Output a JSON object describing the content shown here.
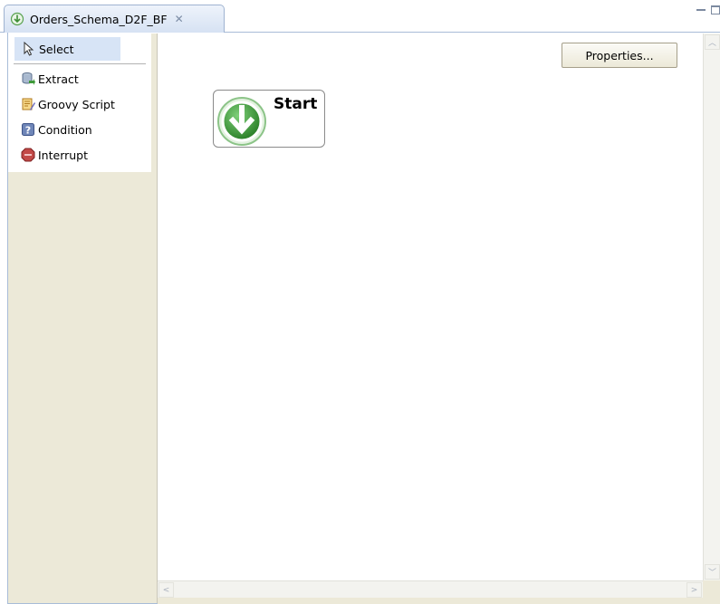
{
  "editor": {
    "tab_title": "Orders_Schema_D2F_BF",
    "tab_close": "✕",
    "tab_icon": "flow-icon"
  },
  "palette": {
    "items": [
      {
        "label": "Select",
        "icon": "select-arrow-icon",
        "selected": true
      },
      {
        "label": "Extract",
        "icon": "extract-icon"
      },
      {
        "label": "Groovy Script",
        "icon": "groovy-script-icon"
      },
      {
        "label": "Condition",
        "icon": "condition-icon"
      },
      {
        "label": "Interrupt",
        "icon": "interrupt-icon"
      }
    ]
  },
  "canvas": {
    "properties_button": "Properties...",
    "start_node": {
      "label": "Start",
      "icon": "start-arrow-icon"
    }
  },
  "scrollbars": {
    "up_arrow": "︿",
    "down_arrow": "﹀",
    "left_arrow": "<",
    "right_arrow": ">"
  },
  "colors": {
    "palette_bg": "#ece9d8",
    "selected_bg": "#d7e4f6",
    "start_green": "#3f9a3a"
  }
}
